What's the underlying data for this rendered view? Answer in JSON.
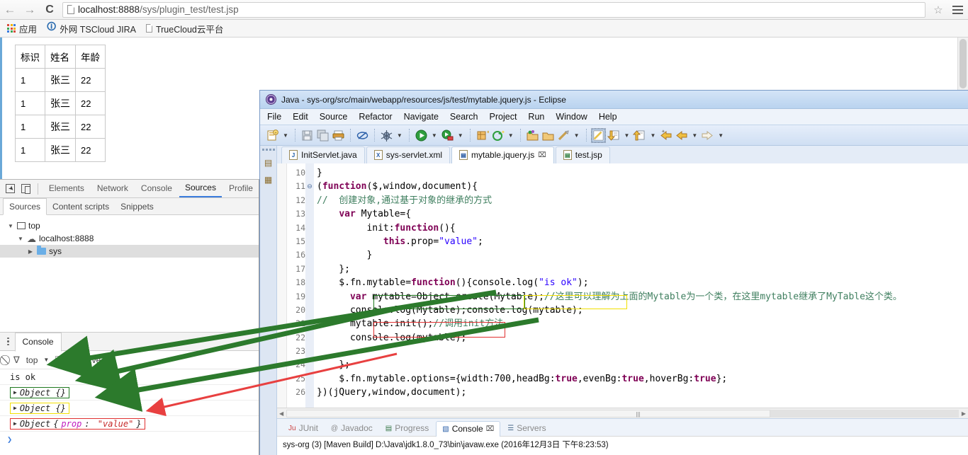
{
  "browser": {
    "back_label": "←",
    "forward_label": "→",
    "reload_label": "⟳",
    "url_host": "localhost:8888",
    "url_path": "/sys/plugin_test/test.jsp",
    "star_label": "☆",
    "bookmarks": [
      {
        "label": "应用",
        "icon": "apps-grid-icon"
      },
      {
        "label": "外网 TSCloud JIRA",
        "icon": "jira-icon"
      },
      {
        "label": "TrueCloud云平台",
        "icon": "page-icon"
      }
    ]
  },
  "page": {
    "table": {
      "headers": [
        "标识",
        "姓名",
        "年龄"
      ],
      "rows": [
        [
          "1",
          "张三",
          "22"
        ],
        [
          "1",
          "张三",
          "22"
        ],
        [
          "1",
          "张三",
          "22"
        ],
        [
          "1",
          "张三",
          "22"
        ]
      ]
    }
  },
  "devtools": {
    "tabs": [
      {
        "label": "Elements",
        "active": false
      },
      {
        "label": "Network",
        "active": false
      },
      {
        "label": "Console",
        "active": false
      },
      {
        "label": "Sources",
        "active": true
      },
      {
        "label": "Profile",
        "active": false
      }
    ],
    "subtabs": [
      {
        "label": "Sources",
        "active": true
      },
      {
        "label": "Content scripts",
        "active": false
      },
      {
        "label": "Snippets",
        "active": false
      }
    ],
    "tree": [
      {
        "label": "top",
        "icon": "frame-icon",
        "twisty": "▼",
        "selected": false
      },
      {
        "label": "localhost:8888",
        "icon": "cloud-icon",
        "twisty": "▼",
        "selected": false
      },
      {
        "label": "sys",
        "icon": "folder-icon",
        "twisty": "▶",
        "selected": true
      }
    ],
    "console": {
      "tab_label": "Console",
      "clear_icon": "⃠",
      "filter_icon": "∇",
      "context": "top",
      "caret": "▼",
      "preserve_log_label": "Preserve log",
      "prompt": "❯",
      "messages": [
        {
          "text": "is ok",
          "kind": "plain",
          "box": "none"
        },
        {
          "text": "Object {}",
          "kind": "object",
          "box": "green"
        },
        {
          "text": "Object {}",
          "kind": "object",
          "box": "yellow"
        },
        {
          "text": "Object {prop: \"value\"}",
          "kind": "object",
          "box": "red",
          "obj_label": "Object",
          "obj_key": "prop",
          "obj_val": "\"value\""
        }
      ]
    }
  },
  "eclipse": {
    "title": "Java - sys-org/src/main/webapp/resources/js/test/mytable.jquery.js - Eclipse",
    "menus": [
      "File",
      "Edit",
      "Source",
      "Refactor",
      "Navigate",
      "Search",
      "Project",
      "Run",
      "Window",
      "Help"
    ],
    "editor_tabs": [
      {
        "label": "InitServlet.java",
        "icon": "java-file-icon",
        "active": false,
        "closable": false
      },
      {
        "label": "sys-servlet.xml",
        "icon": "xml-file-icon",
        "active": false,
        "closable": false
      },
      {
        "label": "mytable.jquery.js",
        "icon": "js-file-icon",
        "active": true,
        "closable": true
      },
      {
        "label": "test.jsp",
        "icon": "jsp-file-icon",
        "active": false,
        "closable": false
      }
    ],
    "tab_close_glyph": "⌧",
    "code": {
      "first_line_number": 10,
      "lines": [
        {
          "n": 10,
          "fold": "",
          "html": "}"
        },
        {
          "n": 11,
          "fold": "⊖",
          "html": "(<b class=\"kw\">function</b>($,window,document){"
        },
        {
          "n": 12,
          "fold": "",
          "html": "<span class=\"cmt\">//  创建对象,通过基于对象的继承的方式</span>"
        },
        {
          "n": 13,
          "fold": "",
          "html": "    <b class=\"kw\">var</b> Mytable={"
        },
        {
          "n": 14,
          "fold": "",
          "html": "         init:<b class=\"kw\">function</b>(){"
        },
        {
          "n": 15,
          "fold": "",
          "html": "            <b class=\"kw\">this</b>.prop=<span class=\"str\">\"value\"</span>;"
        },
        {
          "n": 16,
          "fold": "",
          "html": "         }"
        },
        {
          "n": 17,
          "fold": "",
          "html": "    };"
        },
        {
          "n": 18,
          "fold": "",
          "html": "    $.fn.mytable=<b class=\"kw\">function</b>(){console.log(<span class=\"str\">\"is ok\"</span>);"
        },
        {
          "n": 19,
          "fold": "",
          "html": "      <b class=\"kw\">var</b> mytable=Object.create(Mytable);<span class=\"cmt\">//这里可以理解为上面的Mytable为一个类，在这里mytable继承了MyTable这个类。</span>"
        },
        {
          "n": 20,
          "fold": "",
          "html": "      console.log(Mytable);console.log(mytable);"
        },
        {
          "n": 21,
          "fold": "",
          "html": "      mytable.init();<span class=\"cmt\">//调用init方法</span>"
        },
        {
          "n": 22,
          "fold": "",
          "html": "      console.log(mytable);"
        },
        {
          "n": 23,
          "fold": "",
          "html": ""
        },
        {
          "n": 24,
          "fold": "",
          "html": "    };"
        },
        {
          "n": 25,
          "fold": "",
          "html": "    $.fn.mytable.options={width:700,headBg:<b class=\"kw\">true</b>,evenBg:<b class=\"kw\">true</b>,hoverBg:<b class=\"kw\">true</b>};"
        },
        {
          "n": 26,
          "fold": "",
          "html": "})(jQuery,window,document);"
        }
      ]
    },
    "bottom_tabs": [
      {
        "label": "JUnit",
        "icon": "junit-icon",
        "active": false
      },
      {
        "label": "Javadoc",
        "icon": "javadoc-icon",
        "active": false
      },
      {
        "label": "Progress",
        "icon": "progress-icon",
        "active": false
      },
      {
        "label": "Console",
        "icon": "console-icon",
        "active": true
      },
      {
        "label": "Servers",
        "icon": "servers-icon",
        "active": false
      }
    ],
    "console_line": "sys-org (3) [Maven Build] D:\\Java\\jdk1.8.0_73\\bin\\javaw.exe (2016年12月3日 下午8:23:53)"
  },
  "annotations": {
    "green_color": "#2c7a2c",
    "red_color": "#e84040",
    "yellow_color": "#f2e000",
    "box_green": "#1f7a1f",
    "box_red": "#e03030"
  }
}
